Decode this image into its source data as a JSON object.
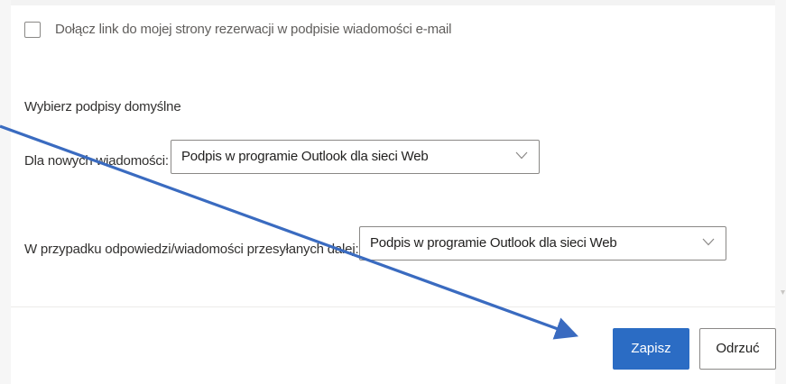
{
  "signature_link": {
    "checked": false,
    "label": "Dołącz link do mojej strony rezerwacji w podpisie wiadomości e-mail"
  },
  "default_signatures": {
    "heading": "Wybierz podpisy domyślne",
    "new_messages": {
      "label": "Dla nowych wiadomości:",
      "value": "Podpis w programie Outlook dla sieci Web"
    },
    "replies_forwards": {
      "label": "W przypadku odpowiedzi/wiadomości przesyłanych dalej:",
      "value": "Podpis w programie Outlook dla sieci Web"
    }
  },
  "footer": {
    "save_label": "Zapisz",
    "discard_label": "Odrzuć"
  },
  "colors": {
    "primary": "#2b6cc4",
    "annotation_arrow": "#3a6bc0"
  },
  "icons": {
    "dropdown": "chevron-down-icon",
    "annotation": "arrow-icon"
  }
}
